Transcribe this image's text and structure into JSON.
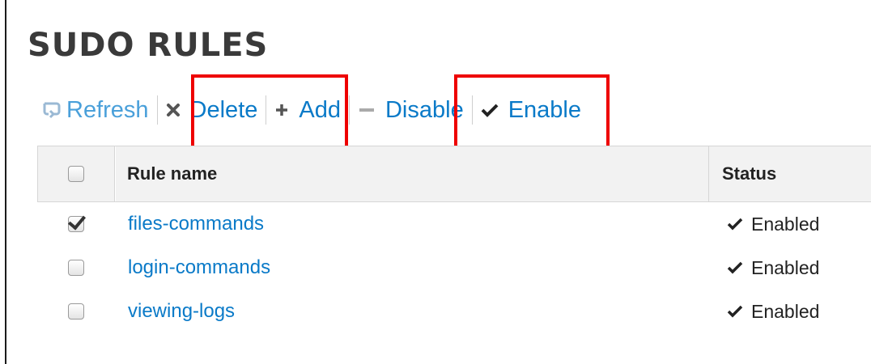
{
  "page": {
    "title": "SUDO RULES"
  },
  "toolbar": {
    "refresh_label": "Refresh",
    "refresh_icon": "refresh-icon",
    "delete_label": "Delete",
    "delete_icon": "close-icon",
    "add_label": "Add",
    "add_icon": "plus-icon",
    "disable_label": "Disable",
    "disable_icon": "minus-icon",
    "enable_label": "Enable",
    "enable_icon": "check-icon"
  },
  "table": {
    "columns": [
      "",
      "Rule name",
      "Status"
    ],
    "rows": [
      {
        "checked": true,
        "name": "files-commands",
        "status": "Enabled"
      },
      {
        "checked": false,
        "name": "login-commands",
        "status": "Enabled"
      },
      {
        "checked": false,
        "name": "viewing-logs",
        "status": "Enabled"
      }
    ]
  },
  "colors": {
    "link": "#0a7ac8",
    "highlight": "#ee0000",
    "header_bg": "#f2f2f2"
  }
}
